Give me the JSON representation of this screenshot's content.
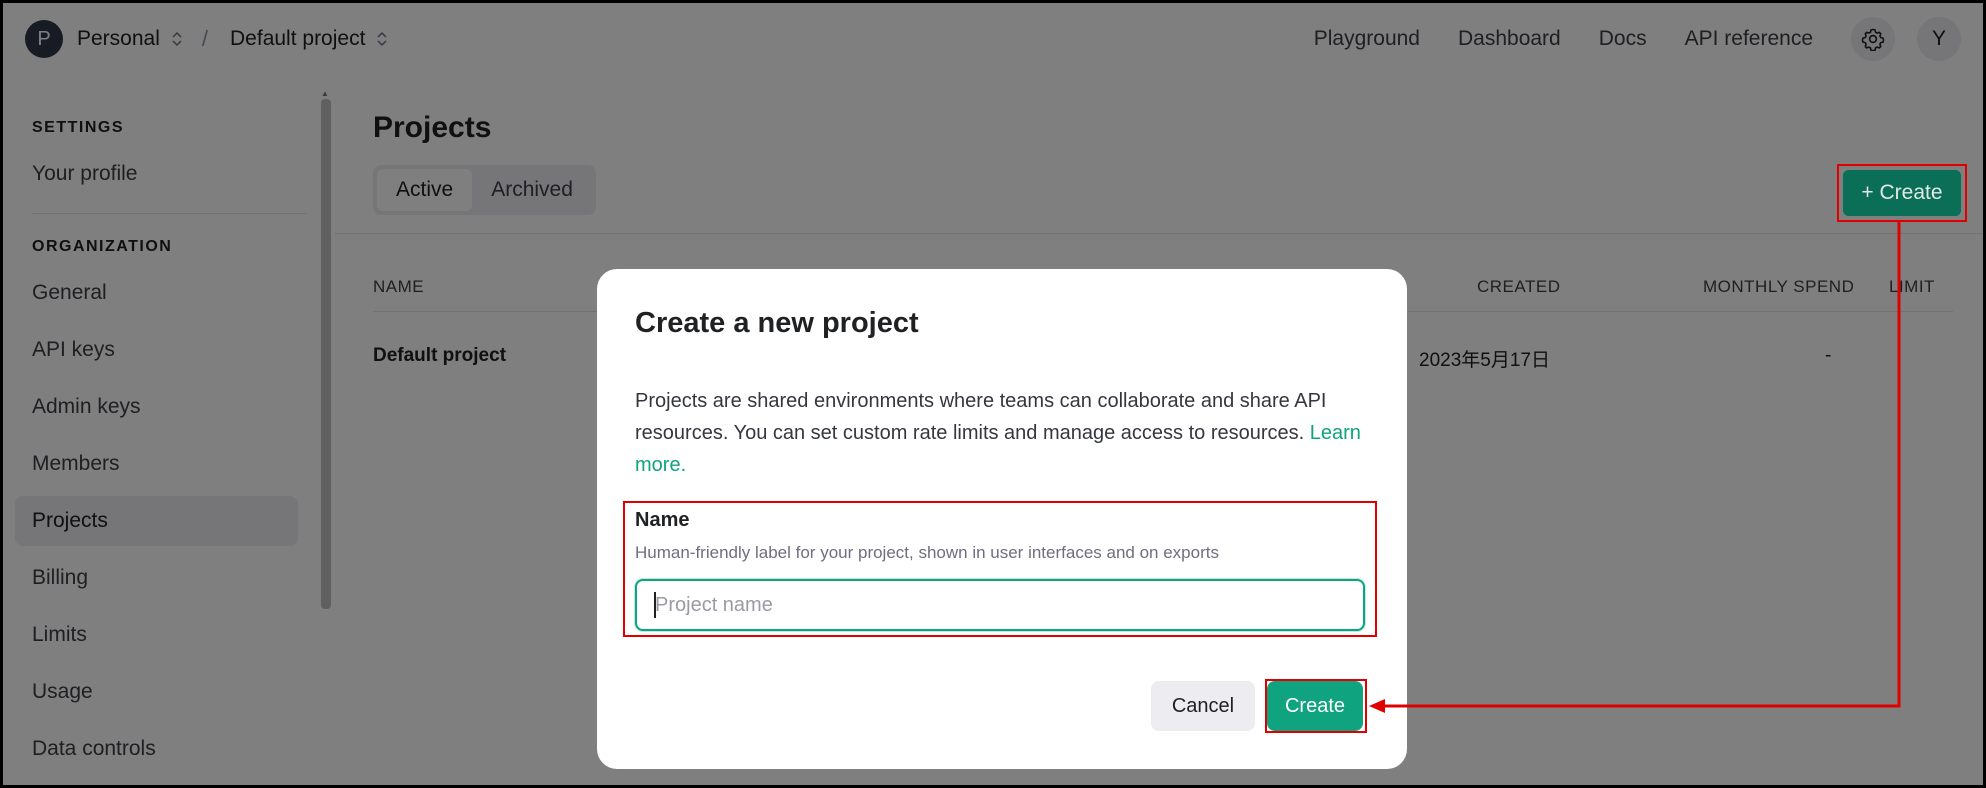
{
  "topbar": {
    "org_initial": "P",
    "org_name": "Personal",
    "project_name": "Default project",
    "nav": [
      "Playground",
      "Dashboard",
      "Docs",
      "API reference"
    ],
    "user_initial": "Y"
  },
  "sidebar": {
    "sections": [
      {
        "title": "SETTINGS",
        "items": [
          "Your profile"
        ]
      },
      {
        "title": "ORGANIZATION",
        "items": [
          "General",
          "API keys",
          "Admin keys",
          "Members",
          "Projects",
          "Billing",
          "Limits",
          "Usage",
          "Data controls"
        ]
      }
    ],
    "active_item": "Projects"
  },
  "main": {
    "title": "Projects",
    "tabs": [
      {
        "label": "Active",
        "active": true
      },
      {
        "label": "Archived",
        "active": false
      }
    ],
    "create_button": "+ Create",
    "table": {
      "columns": [
        "NAME",
        "CREATED",
        "MONTHLY SPEND",
        "LIMIT"
      ],
      "rows": [
        {
          "name": "Default project",
          "created": "2023年5月17日",
          "monthly_spend": "-",
          "limit": ""
        }
      ]
    }
  },
  "modal": {
    "title": "Create a new project",
    "description": "Projects are shared environments where teams can collaborate and share API resources. You can set custom rate limits and manage access to resources.",
    "learn_more": "Learn more.",
    "field_label": "Name",
    "field_hint": "Human-friendly label for your project, shown in user interfaces and on exports",
    "input_placeholder": "Project name",
    "input_value": "",
    "cancel_label": "Cancel",
    "create_label": "Create"
  },
  "colors": {
    "accent": "#10a37f",
    "highlight": "#e00000",
    "overlay": "rgba(0,0,0,0.5)"
  },
  "icons": [
    "chevron-up-down-icon",
    "gear-icon"
  ]
}
